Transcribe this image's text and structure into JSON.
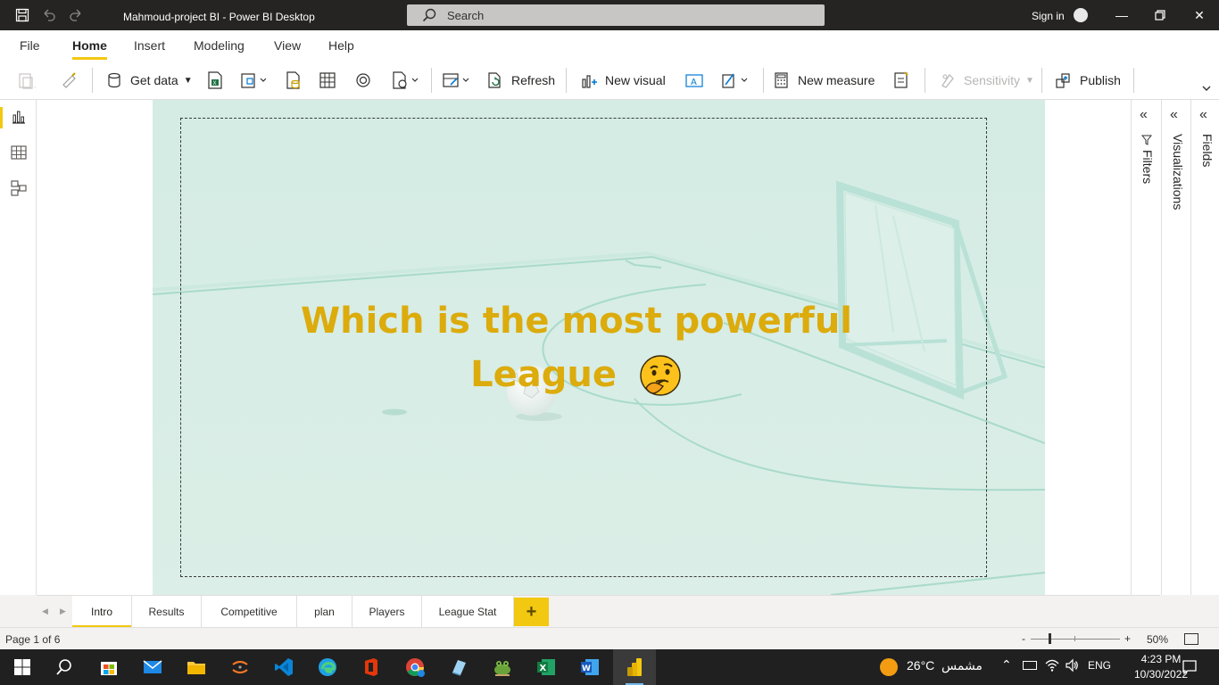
{
  "window": {
    "title": "Mahmoud-project BI - Power BI Desktop",
    "search_placeholder": "Search",
    "signin_label": "Sign in"
  },
  "menu": {
    "items": [
      "File",
      "Home",
      "Insert",
      "Modeling",
      "View",
      "Help"
    ],
    "active": "Home"
  },
  "ribbon": {
    "get_data": "Get data",
    "refresh": "Refresh",
    "new_visual": "New visual",
    "new_measure": "New measure",
    "sensitivity": "Sensitivity",
    "publish": "Publish"
  },
  "report": {
    "headline_line1": "Which is the most powerful",
    "headline_line2": "League"
  },
  "panes": {
    "filters": "Filters",
    "visualizations": "Visualizations",
    "fields": "Fields"
  },
  "tabs": {
    "items": [
      "Intro",
      "Results",
      "Competitive",
      "plan",
      "Players",
      "League Stat"
    ],
    "active": "Intro",
    "add_label": "+"
  },
  "status": {
    "page_indicator": "Page 1 of 6",
    "zoom_minus": "-",
    "zoom_plus": "+",
    "zoom_percent": "50%"
  },
  "taskbar": {
    "weather_temp": "26°C",
    "weather_label": "مشمس",
    "language": "ENG",
    "time": "4:23 PM",
    "date": "10/30/2022"
  },
  "colors": {
    "accent": "#f2c811",
    "headline": "#dcab0c",
    "page_background": "#daeee6",
    "titlebar": "#252423"
  }
}
